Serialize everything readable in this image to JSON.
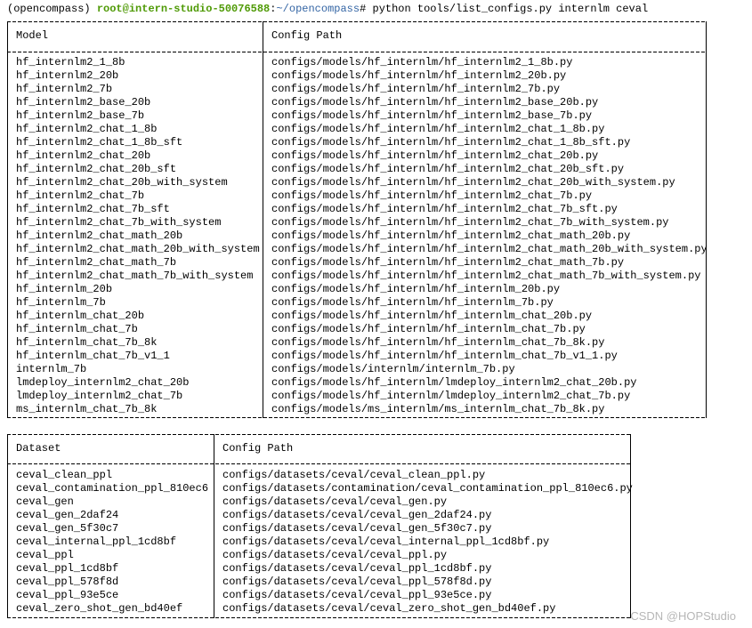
{
  "terminal": {
    "prompt_env": "(opencompass)",
    "prompt_userhost": "root@intern-studio-50076588",
    "prompt_colon": ":",
    "prompt_path": "~/opencompass",
    "prompt_hash": "#",
    "command": "python tools/list_configs.py internlm ceval"
  },
  "models_table": {
    "header": [
      "Model",
      "Config Path"
    ],
    "rows": [
      [
        "hf_internlm2_1_8b",
        "configs/models/hf_internlm/hf_internlm2_1_8b.py"
      ],
      [
        "hf_internlm2_20b",
        "configs/models/hf_internlm/hf_internlm2_20b.py"
      ],
      [
        "hf_internlm2_7b",
        "configs/models/hf_internlm/hf_internlm2_7b.py"
      ],
      [
        "hf_internlm2_base_20b",
        "configs/models/hf_internlm/hf_internlm2_base_20b.py"
      ],
      [
        "hf_internlm2_base_7b",
        "configs/models/hf_internlm/hf_internlm2_base_7b.py"
      ],
      [
        "hf_internlm2_chat_1_8b",
        "configs/models/hf_internlm/hf_internlm2_chat_1_8b.py"
      ],
      [
        "hf_internlm2_chat_1_8b_sft",
        "configs/models/hf_internlm/hf_internlm2_chat_1_8b_sft.py"
      ],
      [
        "hf_internlm2_chat_20b",
        "configs/models/hf_internlm/hf_internlm2_chat_20b.py"
      ],
      [
        "hf_internlm2_chat_20b_sft",
        "configs/models/hf_internlm/hf_internlm2_chat_20b_sft.py"
      ],
      [
        "hf_internlm2_chat_20b_with_system",
        "configs/models/hf_internlm/hf_internlm2_chat_20b_with_system.py"
      ],
      [
        "hf_internlm2_chat_7b",
        "configs/models/hf_internlm/hf_internlm2_chat_7b.py"
      ],
      [
        "hf_internlm2_chat_7b_sft",
        "configs/models/hf_internlm/hf_internlm2_chat_7b_sft.py"
      ],
      [
        "hf_internlm2_chat_7b_with_system",
        "configs/models/hf_internlm/hf_internlm2_chat_7b_with_system.py"
      ],
      [
        "hf_internlm2_chat_math_20b",
        "configs/models/hf_internlm/hf_internlm2_chat_math_20b.py"
      ],
      [
        "hf_internlm2_chat_math_20b_with_system",
        "configs/models/hf_internlm/hf_internlm2_chat_math_20b_with_system.py"
      ],
      [
        "hf_internlm2_chat_math_7b",
        "configs/models/hf_internlm/hf_internlm2_chat_math_7b.py"
      ],
      [
        "hf_internlm2_chat_math_7b_with_system",
        "configs/models/hf_internlm/hf_internlm2_chat_math_7b_with_system.py"
      ],
      [
        "hf_internlm_20b",
        "configs/models/hf_internlm/hf_internlm_20b.py"
      ],
      [
        "hf_internlm_7b",
        "configs/models/hf_internlm/hf_internlm_7b.py"
      ],
      [
        "hf_internlm_chat_20b",
        "configs/models/hf_internlm/hf_internlm_chat_20b.py"
      ],
      [
        "hf_internlm_chat_7b",
        "configs/models/hf_internlm/hf_internlm_chat_7b.py"
      ],
      [
        "hf_internlm_chat_7b_8k",
        "configs/models/hf_internlm/hf_internlm_chat_7b_8k.py"
      ],
      [
        "hf_internlm_chat_7b_v1_1",
        "configs/models/hf_internlm/hf_internlm_chat_7b_v1_1.py"
      ],
      [
        "internlm_7b",
        "configs/models/internlm/internlm_7b.py"
      ],
      [
        "lmdeploy_internlm2_chat_20b",
        "configs/models/hf_internlm/lmdeploy_internlm2_chat_20b.py"
      ],
      [
        "lmdeploy_internlm2_chat_7b",
        "configs/models/hf_internlm/lmdeploy_internlm2_chat_7b.py"
      ],
      [
        "ms_internlm_chat_7b_8k",
        "configs/models/ms_internlm/ms_internlm_chat_7b_8k.py"
      ]
    ]
  },
  "datasets_table": {
    "header": [
      "Dataset",
      "Config Path"
    ],
    "rows": [
      [
        "ceval_clean_ppl",
        "configs/datasets/ceval/ceval_clean_ppl.py"
      ],
      [
        "ceval_contamination_ppl_810ec6",
        "configs/datasets/contamination/ceval_contamination_ppl_810ec6.py"
      ],
      [
        "ceval_gen",
        "configs/datasets/ceval/ceval_gen.py"
      ],
      [
        "ceval_gen_2daf24",
        "configs/datasets/ceval/ceval_gen_2daf24.py"
      ],
      [
        "ceval_gen_5f30c7",
        "configs/datasets/ceval/ceval_gen_5f30c7.py"
      ],
      [
        "ceval_internal_ppl_1cd8bf",
        "configs/datasets/ceval/ceval_internal_ppl_1cd8bf.py"
      ],
      [
        "ceval_ppl",
        "configs/datasets/ceval/ceval_ppl.py"
      ],
      [
        "ceval_ppl_1cd8bf",
        "configs/datasets/ceval/ceval_ppl_1cd8bf.py"
      ],
      [
        "ceval_ppl_578f8d",
        "configs/datasets/ceval/ceval_ppl_578f8d.py"
      ],
      [
        "ceval_ppl_93e5ce",
        "configs/datasets/ceval/ceval_ppl_93e5ce.py"
      ],
      [
        "ceval_zero_shot_gen_bd40ef",
        "configs/datasets/ceval/ceval_zero_shot_gen_bd40ef.py"
      ]
    ]
  },
  "watermark": "CSDN @HOPStudio"
}
